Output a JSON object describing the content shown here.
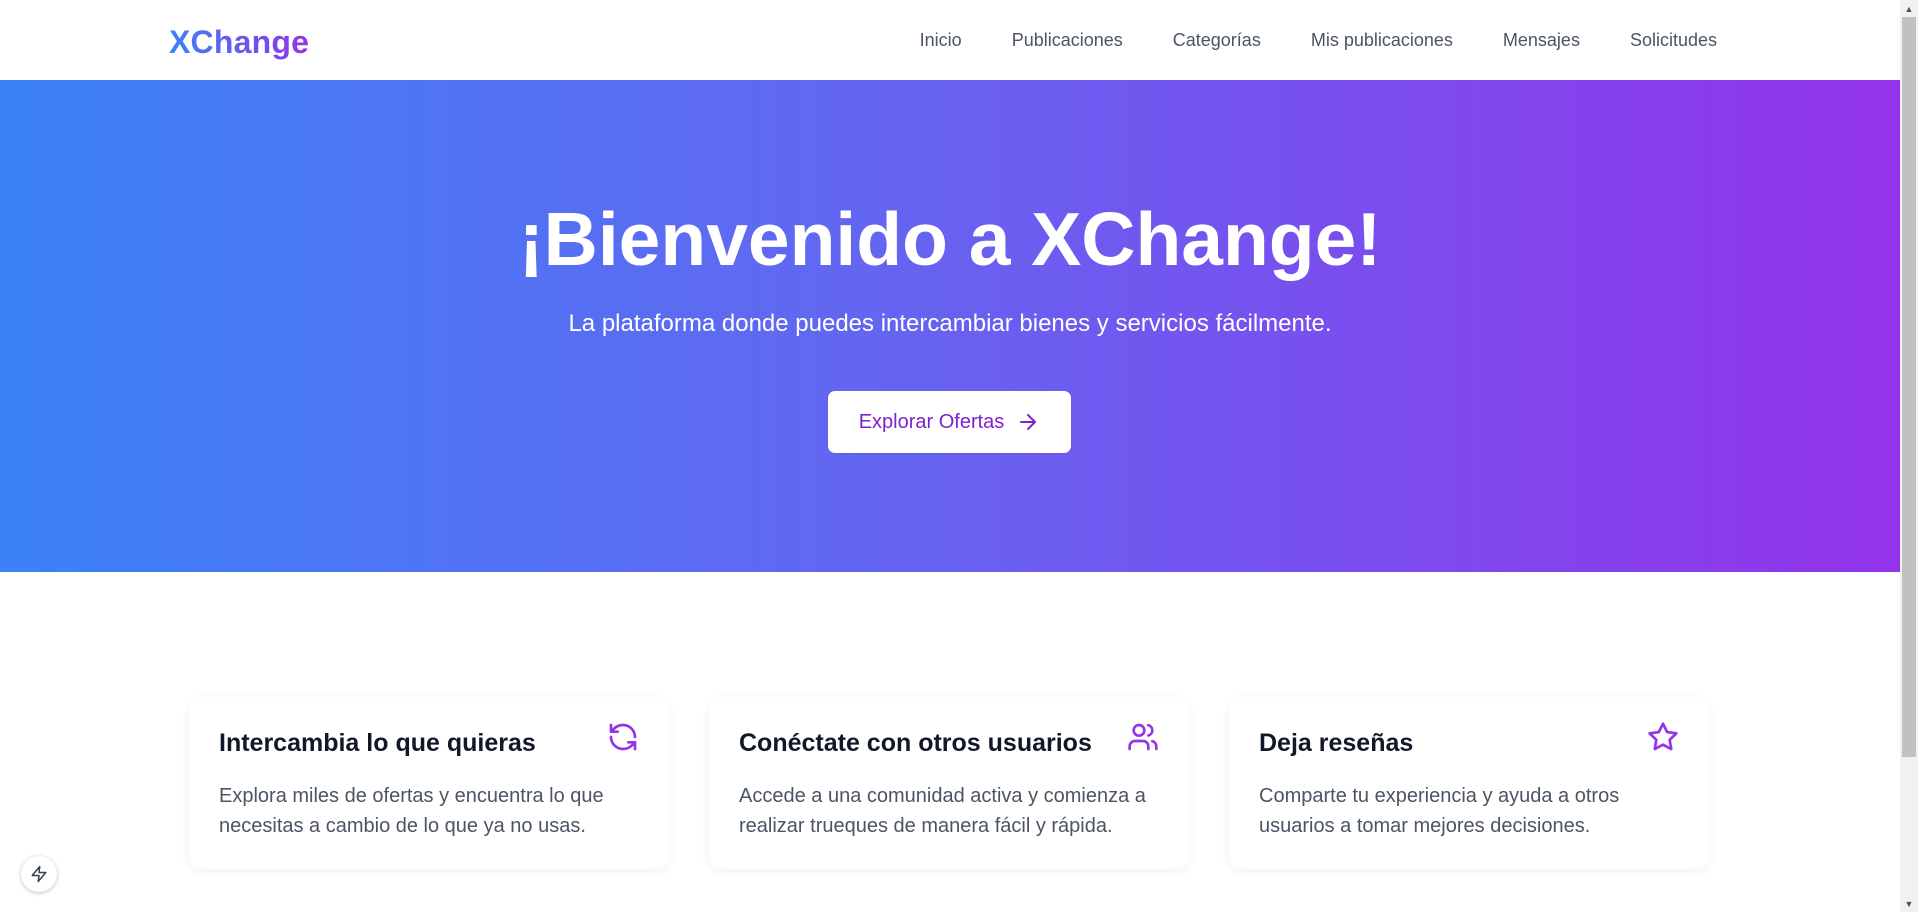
{
  "header": {
    "logo": "XChange",
    "nav": [
      "Inicio",
      "Publicaciones",
      "Categorías",
      "Mis publicaciones",
      "Mensajes",
      "Solicitudes"
    ]
  },
  "hero": {
    "title": "¡Bienvenido a XChange!",
    "subtitle": "La plataforma donde puedes intercambiar bienes y servicios fácilmente.",
    "cta_label": "Explorar Ofertas",
    "cta_icon": "arrow-right-icon"
  },
  "features": [
    {
      "title": "Intercambia lo que quieras",
      "desc": "Explora miles de ofertas y encuentra lo que necesitas a cambio de lo que ya no usas.",
      "icon": "refresh-icon"
    },
    {
      "title": "Conéctate con otros usuarios",
      "desc": "Accede a una comunidad activa y comienza a realizar trueques de manera fácil y rápida.",
      "icon": "users-icon"
    },
    {
      "title": "Deja reseñas",
      "desc": "Comparte tu experiencia y ayuda a otros usuarios a tomar mejores decisiones.",
      "icon": "star-icon"
    }
  ],
  "colors": {
    "brand_start": "#3b82f6",
    "brand_end": "#9333ea",
    "accent": "#7e22ce"
  }
}
